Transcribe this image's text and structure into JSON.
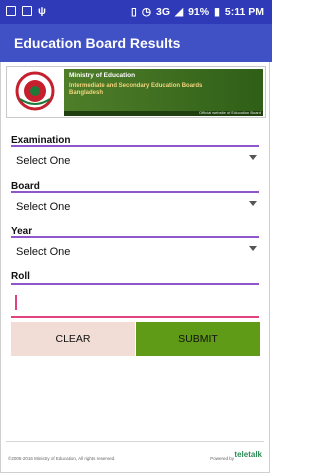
{
  "status_bar": {
    "battery": "91%",
    "time": "5:11 PM",
    "network": "3G"
  },
  "app_bar": {
    "title": "Education Board Results"
  },
  "banner": {
    "ministry": "Ministry of Education",
    "boards": "Intermediate and Secondary Education Boards Bangladesh",
    "official": "Official website of Education Board"
  },
  "form": {
    "examination_label": "Examination",
    "examination_value": "Select One",
    "board_label": "Board",
    "board_value": "Select One",
    "year_label": "Year",
    "year_value": "Select One",
    "roll_label": "Roll",
    "roll_value": ""
  },
  "buttons": {
    "clear": "CLEAR",
    "submit": "SUBMIT"
  },
  "footer": {
    "copyright": "©2005-2016 Ministry of Education, All rights reserved.",
    "powered_by": "Powered by",
    "brand": "teletalk"
  },
  "colors": {
    "status_bar": "#2e3ab8",
    "app_bar": "#3f51c5",
    "underline": "#8e56c9",
    "roll_underline": "#e0437d",
    "clear_bg": "#f2ddd6",
    "submit_bg": "#5f9b17"
  }
}
